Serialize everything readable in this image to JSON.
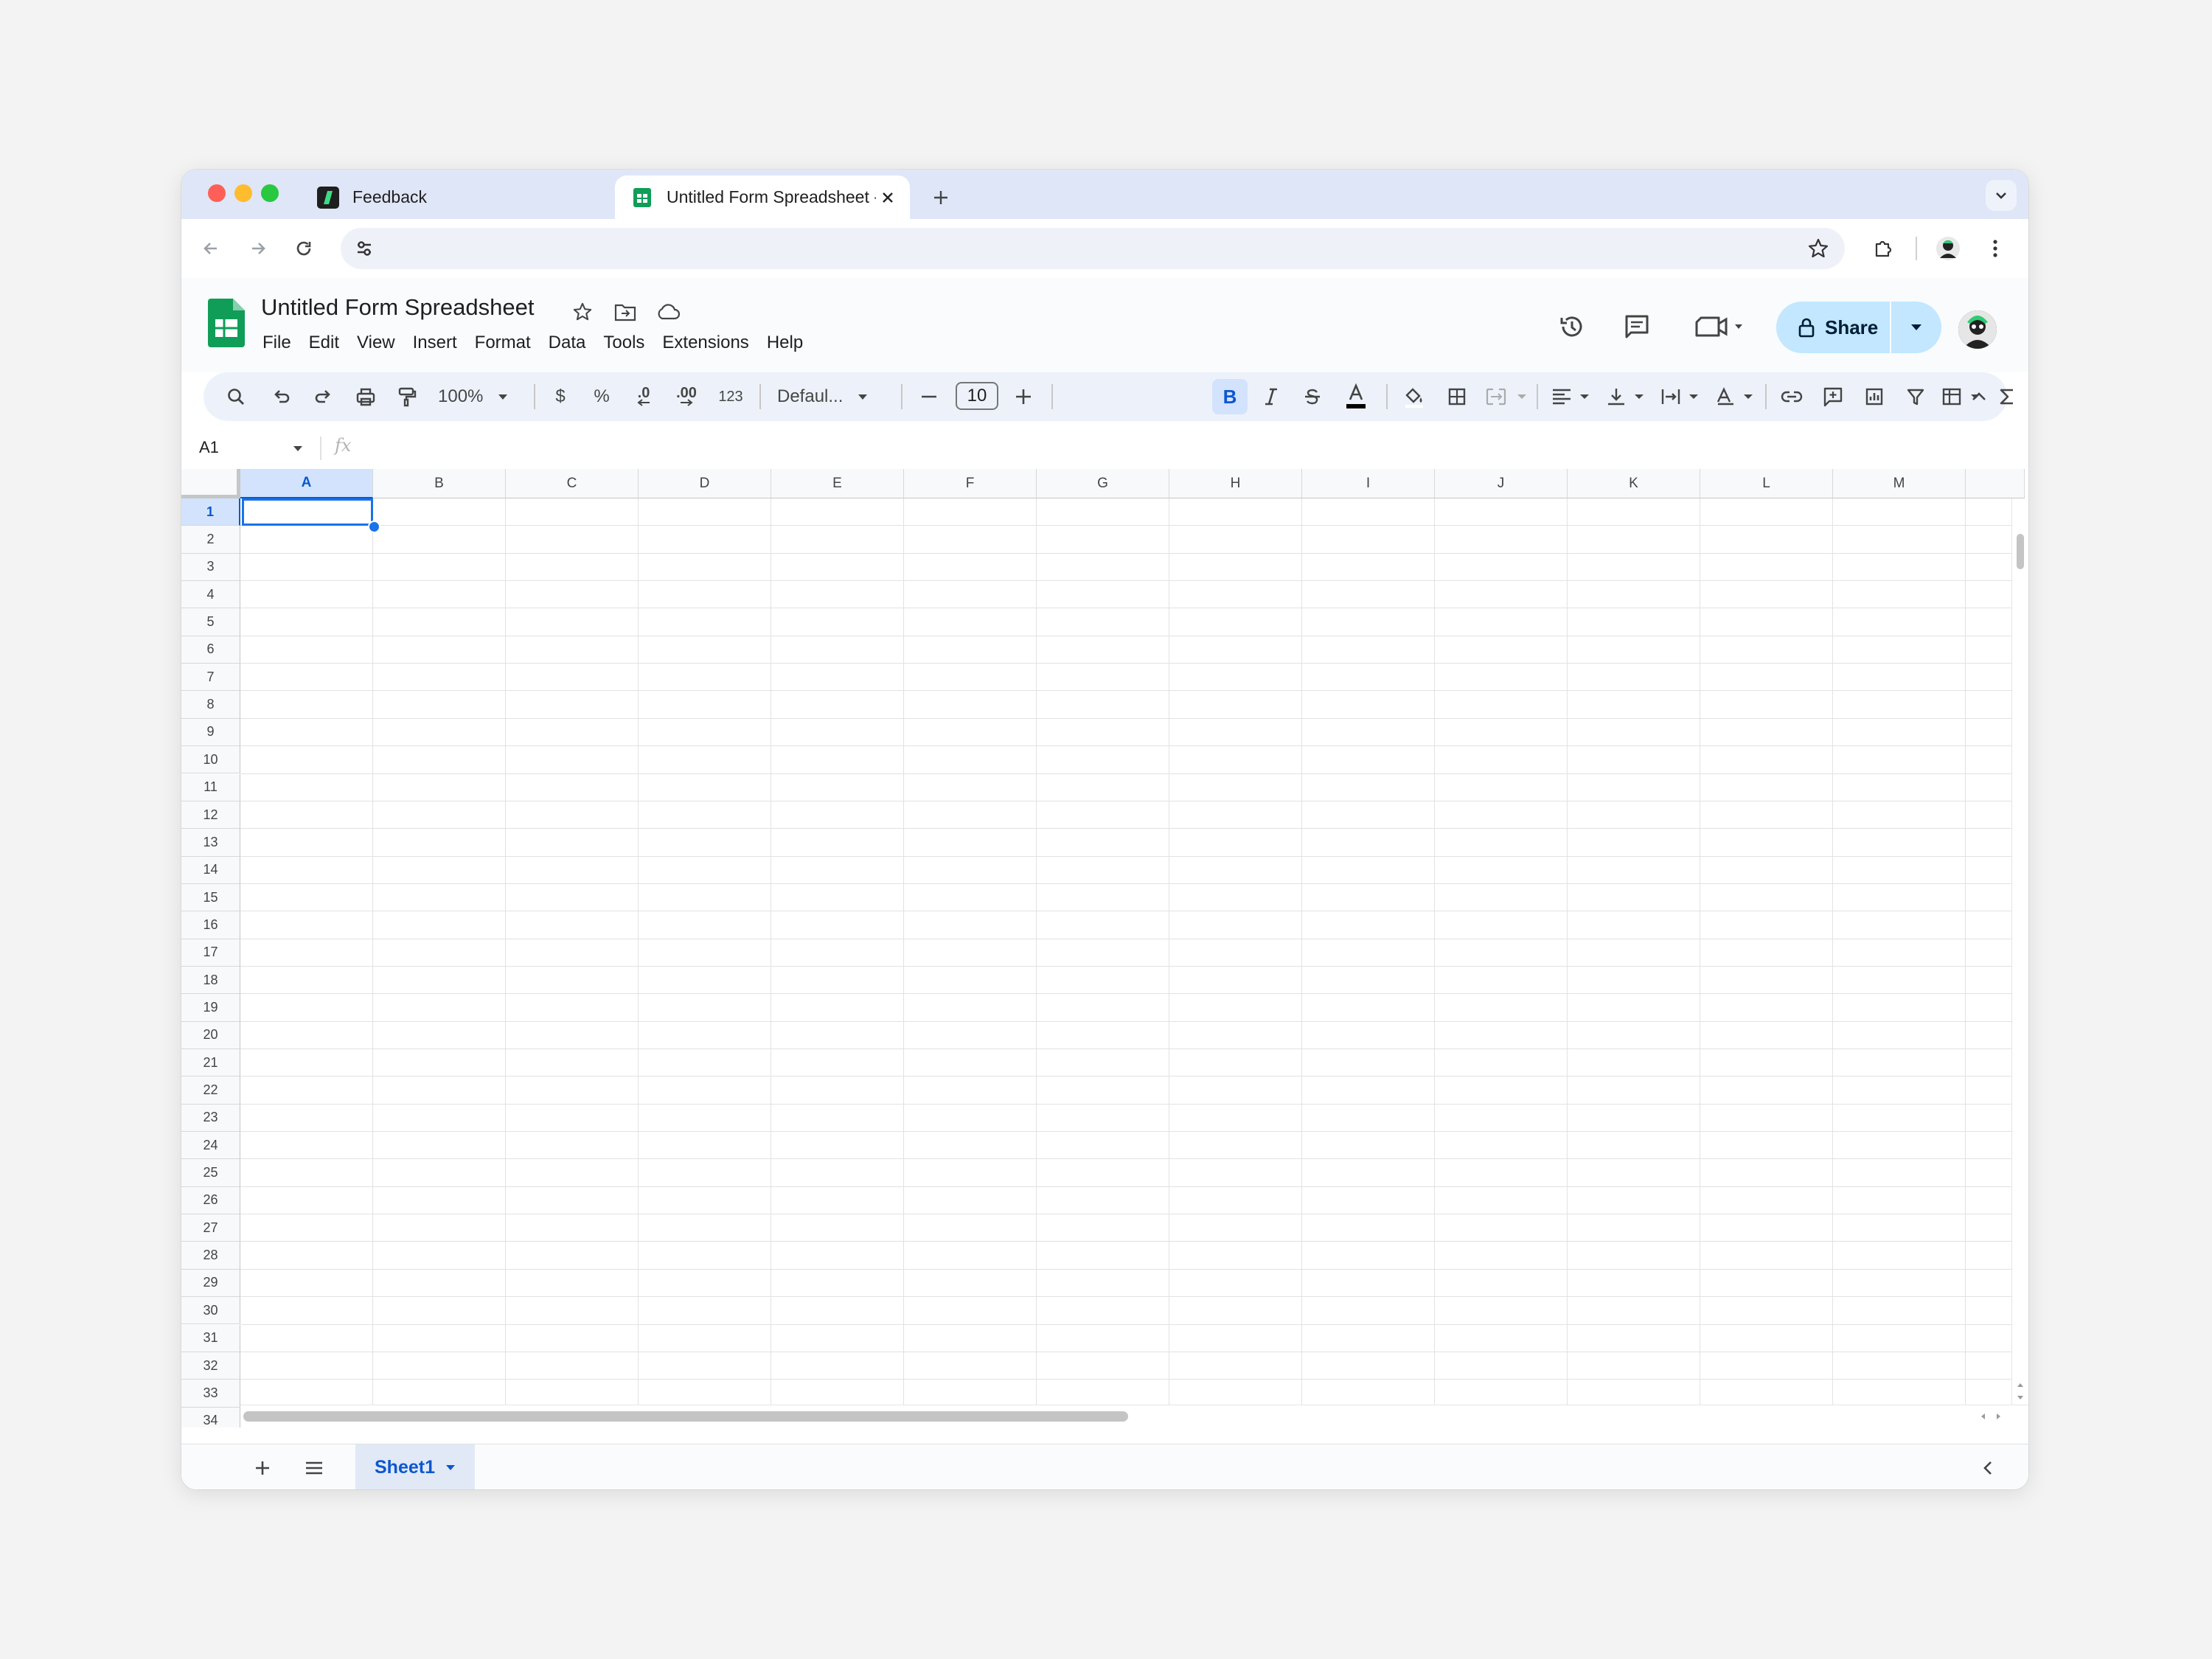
{
  "browser": {
    "tabs": [
      {
        "title": "Feedback",
        "active": false
      },
      {
        "title": "Untitled Form Spreadsheet - Goo",
        "active": true
      }
    ],
    "address": ""
  },
  "app": {
    "doc_title": "Untitled Form Spreadsheet",
    "menu": [
      "File",
      "Edit",
      "View",
      "Insert",
      "Format",
      "Data",
      "Tools",
      "Extensions",
      "Help"
    ],
    "share_label": "Share",
    "brand_color": "#0f9d58",
    "accent_color": "#0b57d0"
  },
  "toolbar": {
    "zoom": "100%",
    "currency": "$",
    "percent": "%",
    "decrease_decimal": ".0",
    "increase_decimal": ".00",
    "number_format": "123",
    "font": "Defaul...",
    "font_size": "10",
    "bold": "B"
  },
  "formula_bar": {
    "cell_ref": "A1",
    "fx": "fx",
    "value": ""
  },
  "grid": {
    "columns": [
      "A",
      "B",
      "C",
      "D",
      "E",
      "F",
      "G",
      "H",
      "I",
      "J",
      "K",
      "L",
      "M"
    ],
    "rows": [
      "1",
      "2",
      "3",
      "4",
      "5",
      "6",
      "7",
      "8",
      "9",
      "10",
      "11",
      "12",
      "13",
      "14",
      "15",
      "16",
      "17",
      "18",
      "19",
      "20",
      "21",
      "22",
      "23",
      "24",
      "25",
      "26",
      "27",
      "28",
      "29",
      "30",
      "31",
      "32",
      "33",
      "34"
    ],
    "selected_cell": "A1"
  },
  "sheets": {
    "tabs": [
      {
        "label": "Sheet1",
        "active": true
      }
    ]
  }
}
